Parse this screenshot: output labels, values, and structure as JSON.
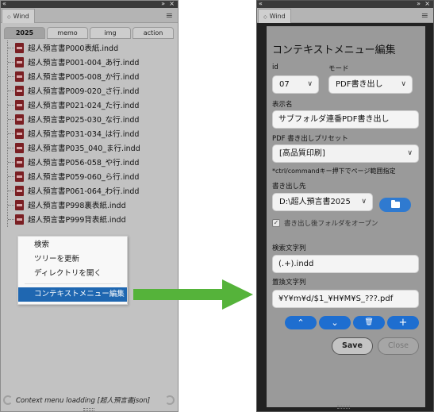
{
  "left_panel": {
    "panel_tab_label": "Wind",
    "tabs": [
      "2025",
      "memo",
      "img",
      "action"
    ],
    "active_tab": "2025",
    "files": [
      "超人預言書P000表紙.indd",
      "超人預言書P001-004_あ行.indd",
      "超人預言書P005-008_か行.indd",
      "超人預言書P009-020_さ行.indd",
      "超人預言書P021-024_た行.indd",
      "超人預言書P025-030_な行.indd",
      "超人預言書P031-034_は行.indd",
      "超人預言書P035_040_ま行.indd",
      "超人預言書P056-058_や行.indd",
      "超人預言書P059-060_ら行.indd",
      "超人預言書P061-064_わ行.indd",
      "超人預言書P998裏表紙.indd",
      "超人預言書P999背表紙.indd"
    ],
    "context_menu": {
      "items": [
        "検索",
        "ツリーを更新",
        "ディレクトリを開く",
        "コンテキストメニュー編集"
      ],
      "selected": "コンテキストメニュー編集"
    },
    "status_text": "Context menu loadding [超人預言書json]"
  },
  "right_panel": {
    "panel_tab_label": "Wind",
    "dialog": {
      "title": "コンテキストメニュー編集",
      "id_label": "id",
      "id_value": "07",
      "mode_label": "モード",
      "mode_value": "PDF書き出し",
      "display_name_label": "表示名",
      "display_name_value": "サブフォルダ連番PDF書き出し",
      "preset_label": "PDF 書き出しプリセット",
      "preset_value": "[高品質印刷]",
      "hint": "*ctrl/commandキー押下でページ範囲指定",
      "output_label": "書き出し先",
      "output_value": "D:\\超人預言書2025",
      "open_folder_label": "書き出し後フォルダをオープン",
      "open_folder_checked": true,
      "search_label": "検索文字列",
      "search_value": "(.+).indd",
      "replace_label": "置換文字列",
      "replace_value": "¥Y¥m¥d/$1_¥H¥M¥S_???.pdf",
      "save_label": "Save",
      "close_label": "Close"
    }
  },
  "icons": {
    "panel_close": "×",
    "panel_collapse": "«",
    "panel_expand": "»",
    "panel_menu": "≡",
    "tab_arrows": "◇",
    "dropdown": "∨",
    "up": "⌃",
    "down": "⌄",
    "delete": "🗑",
    "add": "+"
  },
  "colors": {
    "accent_blue": "#1e6ed0",
    "selection_blue": "#1f67b1",
    "arrow_green": "#55b33a",
    "file_icon": "#7a1f23"
  }
}
